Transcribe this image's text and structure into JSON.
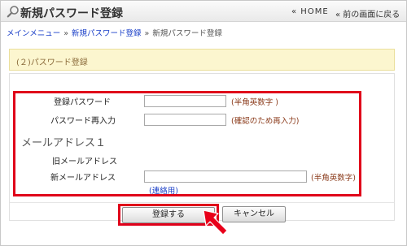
{
  "header": {
    "title": "新規パスワード登録",
    "home_link": "« HOME",
    "back_link": "« 前の画面に戻る"
  },
  "breadcrumb": {
    "items": [
      "メインメニュー",
      "新規パスワード登録"
    ],
    "separator": "»",
    "current": "新規パスワード登録"
  },
  "section": {
    "title": "(２)パスワード登録"
  },
  "form": {
    "password_label": "登録パスワード",
    "password_value": "",
    "password_hint": "(半角英数字 )",
    "password_confirm_label": "パスワード再入力",
    "password_confirm_value": "",
    "password_confirm_hint": "(確認のため再入力)",
    "email_section_label": "メールアドレス１",
    "old_email_label": "旧メールアドレス",
    "old_email_value": "",
    "new_email_label": "新メールアドレス",
    "new_email_value": "",
    "new_email_hint": "(半角英数字)",
    "contact_note": "(連絡用)"
  },
  "buttons": {
    "register": "登録する",
    "cancel": "キャンセル"
  },
  "colors": {
    "highlight": "#e0001a",
    "link": "#1a3fc8",
    "section_bg": "#fcf6cf"
  }
}
